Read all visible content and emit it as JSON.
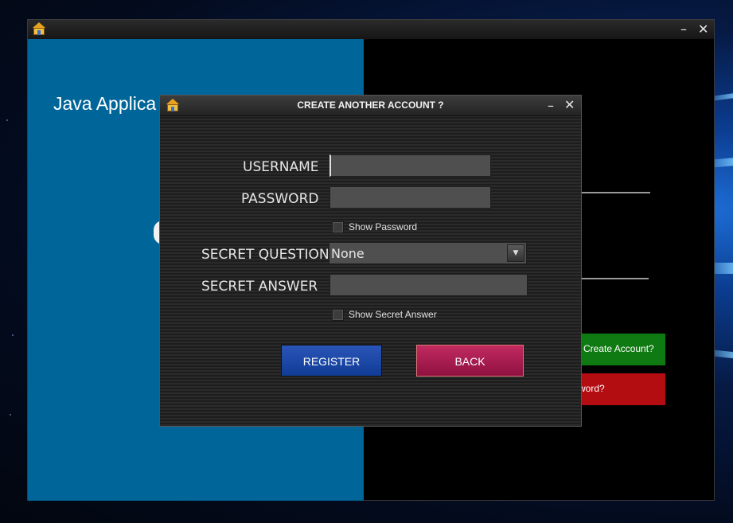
{
  "main_window": {
    "app_title": "Java Applica",
    "create_account_button": "Create Account?",
    "forgot_password_button": "word?",
    "minimize": "–",
    "close": "✕"
  },
  "dialog": {
    "title": "CREATE ANOTHER ACCOUNT ?",
    "minimize": "–",
    "close": "✕",
    "username_label": "USERNAME",
    "username_value": "",
    "password_label": "PASSWORD",
    "password_value": "",
    "show_password_label": "Show Password",
    "secret_question_label": "SECRET QUESTION",
    "secret_question_selected": "None",
    "secret_answer_label": "SECRET ANSWER",
    "secret_answer_value": "",
    "show_secret_answer_label": "Show Secret Answer",
    "register_button": "REGISTER",
    "back_button": "BACK"
  },
  "icons": {
    "app_icon": "house-icon",
    "dropdown_arrow": "chevron-down-icon"
  },
  "colors": {
    "left_panel": "#006699",
    "register": "#1a47a8",
    "back": "#a91a4e",
    "green_button": "#0f7a12",
    "red_button": "#b30d12"
  }
}
